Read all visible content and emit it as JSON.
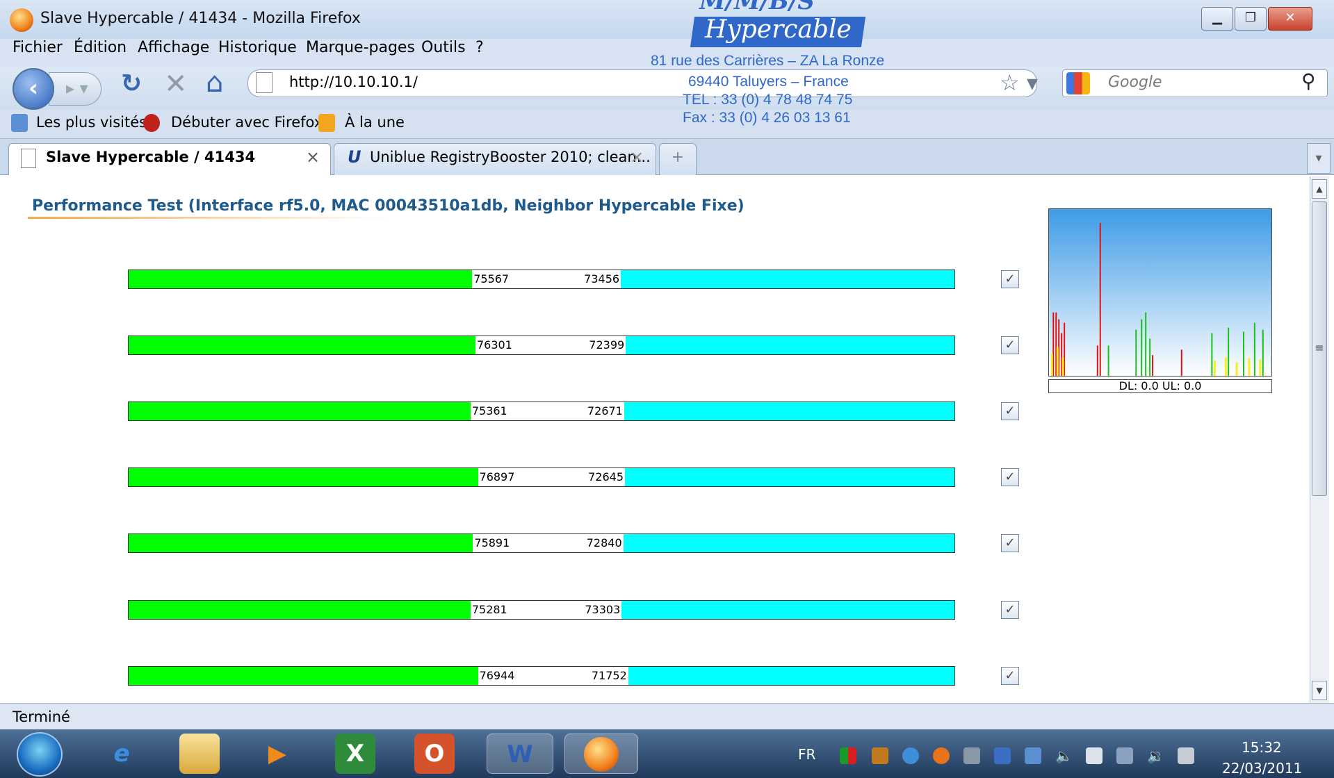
{
  "window": {
    "title": "Slave Hypercable / 41434 - Mozilla Firefox"
  },
  "menu": [
    "Fichier",
    "Édition",
    "Affichage",
    "Historique",
    "Marque-pages",
    "Outils",
    "?"
  ],
  "nav": {
    "url": "http://10.10.10.1/",
    "search_placeholder": "Google"
  },
  "bookmarks": [
    "Les plus visités",
    "Débuter avec Firefox",
    "À la une"
  ],
  "tabs": [
    {
      "label": "Slave Hypercable / 41434",
      "active": true
    },
    {
      "label": "Uniblue RegistryBooster 2010; clean...",
      "active": false
    }
  ],
  "watermark": {
    "logo_top": "M/M/B/S",
    "logo": "Hypercable",
    "lines": [
      "81 rue des Carrières – ZA La Ronze",
      "69440 Taluyers – France",
      "TEL : 33 (0) 4 78 48 74 75",
      "Fax : 33 (0) 4 26 03 13 61"
    ]
  },
  "page": {
    "title": "Performance Test (Interface rf5.0, MAC 00043510a1db, Neighbor Hypercable Fixe)",
    "graph_caption": "DL: 0.0 UL: 0.0",
    "rows": [
      {
        "dl": "75567",
        "ul": "73456",
        "dl_frac": 0.416,
        "ul_frac": 0.404,
        "checked": true
      },
      {
        "dl": "76301",
        "ul": "72399",
        "dl_frac": 0.42,
        "ul_frac": 0.398,
        "checked": true
      },
      {
        "dl": "75361",
        "ul": "72671",
        "dl_frac": 0.414,
        "ul_frac": 0.4,
        "checked": true
      },
      {
        "dl": "76897",
        "ul": "72645",
        "dl_frac": 0.423,
        "ul_frac": 0.399,
        "checked": true
      },
      {
        "dl": "75891",
        "ul": "72840",
        "dl_frac": 0.417,
        "ul_frac": 0.401,
        "checked": true
      },
      {
        "dl": "75281",
        "ul": "73303",
        "dl_frac": 0.414,
        "ul_frac": 0.403,
        "checked": true
      },
      {
        "dl": "76944",
        "ul": "71752",
        "dl_frac": 0.423,
        "ul_frac": 0.395,
        "checked": true
      }
    ]
  },
  "status": "Terminé",
  "taskbar": {
    "lang": "FR",
    "time": "15:32",
    "date": "22/03/2011"
  },
  "colors": {
    "download": "#00ff00",
    "upload": "#00ffff",
    "title": "#1e5b8c"
  }
}
